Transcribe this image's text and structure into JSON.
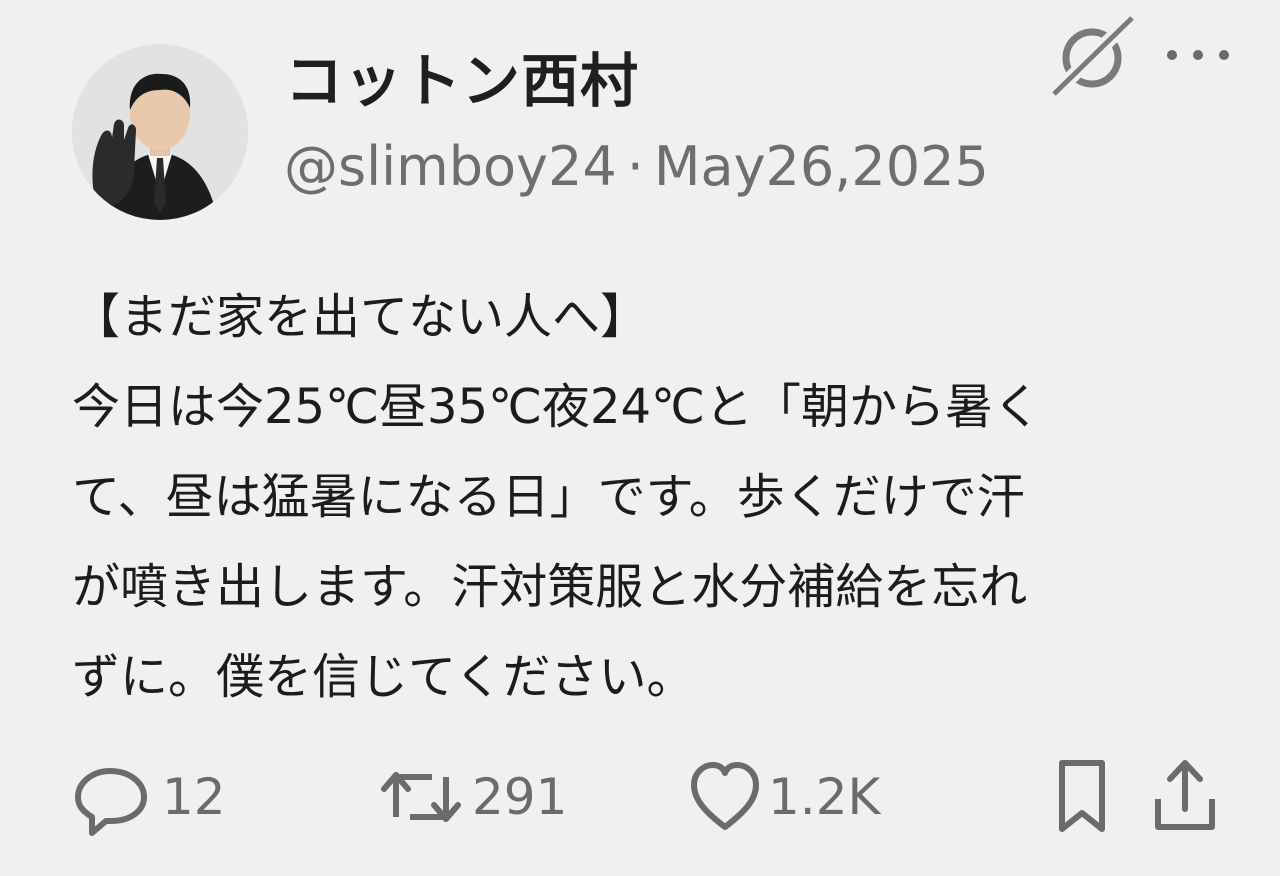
{
  "user": {
    "display_name": "コットン西村",
    "handle": "@slimboy24",
    "separator": "·",
    "date": "May26,2025"
  },
  "header_icons": [
    "grok-icon",
    "more-icon"
  ],
  "tweet": {
    "lines": [
      "【まだ家を出てない人へ】",
      "今日は今25℃昼35℃夜24℃と「朝から暑く",
      "て、昼は猛暑になる日」です。歩くだけで汗",
      "が噴き出します。汗対策服と水分補給を忘れ",
      "ずに。僕を信じてください。"
    ]
  },
  "actions": {
    "reply": {
      "icon": "reply-icon",
      "count": "12"
    },
    "retweet": {
      "icon": "retweet-icon",
      "count": "291"
    },
    "like": {
      "icon": "heart-icon",
      "count": "1.2K"
    },
    "bookmark": {
      "icon": "bookmark-icon"
    },
    "share": {
      "icon": "share-icon"
    }
  },
  "colors": {
    "background": "#f0f0f0",
    "text": "#1c1c1c",
    "muted": "#6e6e6e"
  }
}
